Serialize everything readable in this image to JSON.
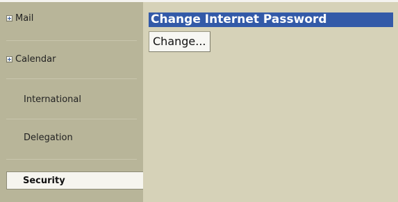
{
  "sidebar": {
    "items": [
      {
        "label": "Mail",
        "expandable": true,
        "icon": "expand-plus-icon"
      },
      {
        "label": "Calendar",
        "expandable": true,
        "icon": "expand-plus-icon"
      },
      {
        "label": "International",
        "expandable": false
      },
      {
        "label": "Delegation",
        "expandable": false
      },
      {
        "label": "Security",
        "expandable": false,
        "selected": true
      }
    ]
  },
  "main": {
    "section_title": "Change Internet Password",
    "change_button_label": "Change..."
  },
  "colors": {
    "sidebar_bg": "#b8b599",
    "content_bg": "#d6d2b8",
    "title_bar_bg": "#335aa8",
    "selected_item_bg": "#f6f5ef"
  }
}
